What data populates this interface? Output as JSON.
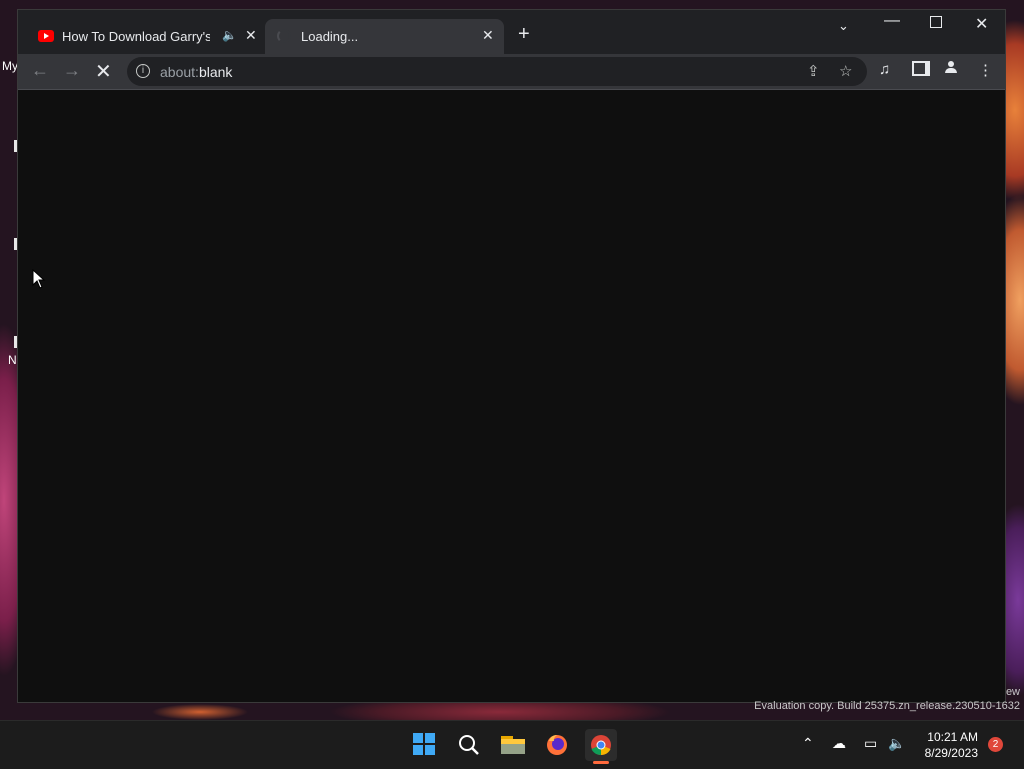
{
  "desktop": {
    "labels": [
      "My",
      "N"
    ],
    "watermark": "Evaluation copy. Build 25375.zn_release.230510-1632",
    "watermark_top": "ew"
  },
  "browser": {
    "tabs": [
      {
        "title": "How To Download Garry's Mod",
        "icon": "youtube-icon",
        "audio": true,
        "active": false
      },
      {
        "title": "Loading...",
        "icon": "loading-spinner-icon",
        "active": true
      }
    ],
    "new_tab": "+",
    "address": {
      "scheme": "about:",
      "host": "blank"
    },
    "controls": {
      "back": "←",
      "forward": "→",
      "stop": "✕"
    },
    "window_controls": {
      "tab_search": "⌄",
      "minimize": "—",
      "close": "✕"
    }
  },
  "taskbar": {
    "apps": [
      "start-icon",
      "search-icon",
      "file-explorer-icon",
      "firefox-icon",
      "chrome-icon"
    ],
    "time": "10:21 AM",
    "date": "8/29/2023",
    "notifications": "2"
  },
  "colors": {
    "content_bg": "#0f0f0f",
    "tab_active": "#35363a",
    "taskbar_bg": "#1c1c1c",
    "accent_chrome": "#ff6a3d"
  }
}
